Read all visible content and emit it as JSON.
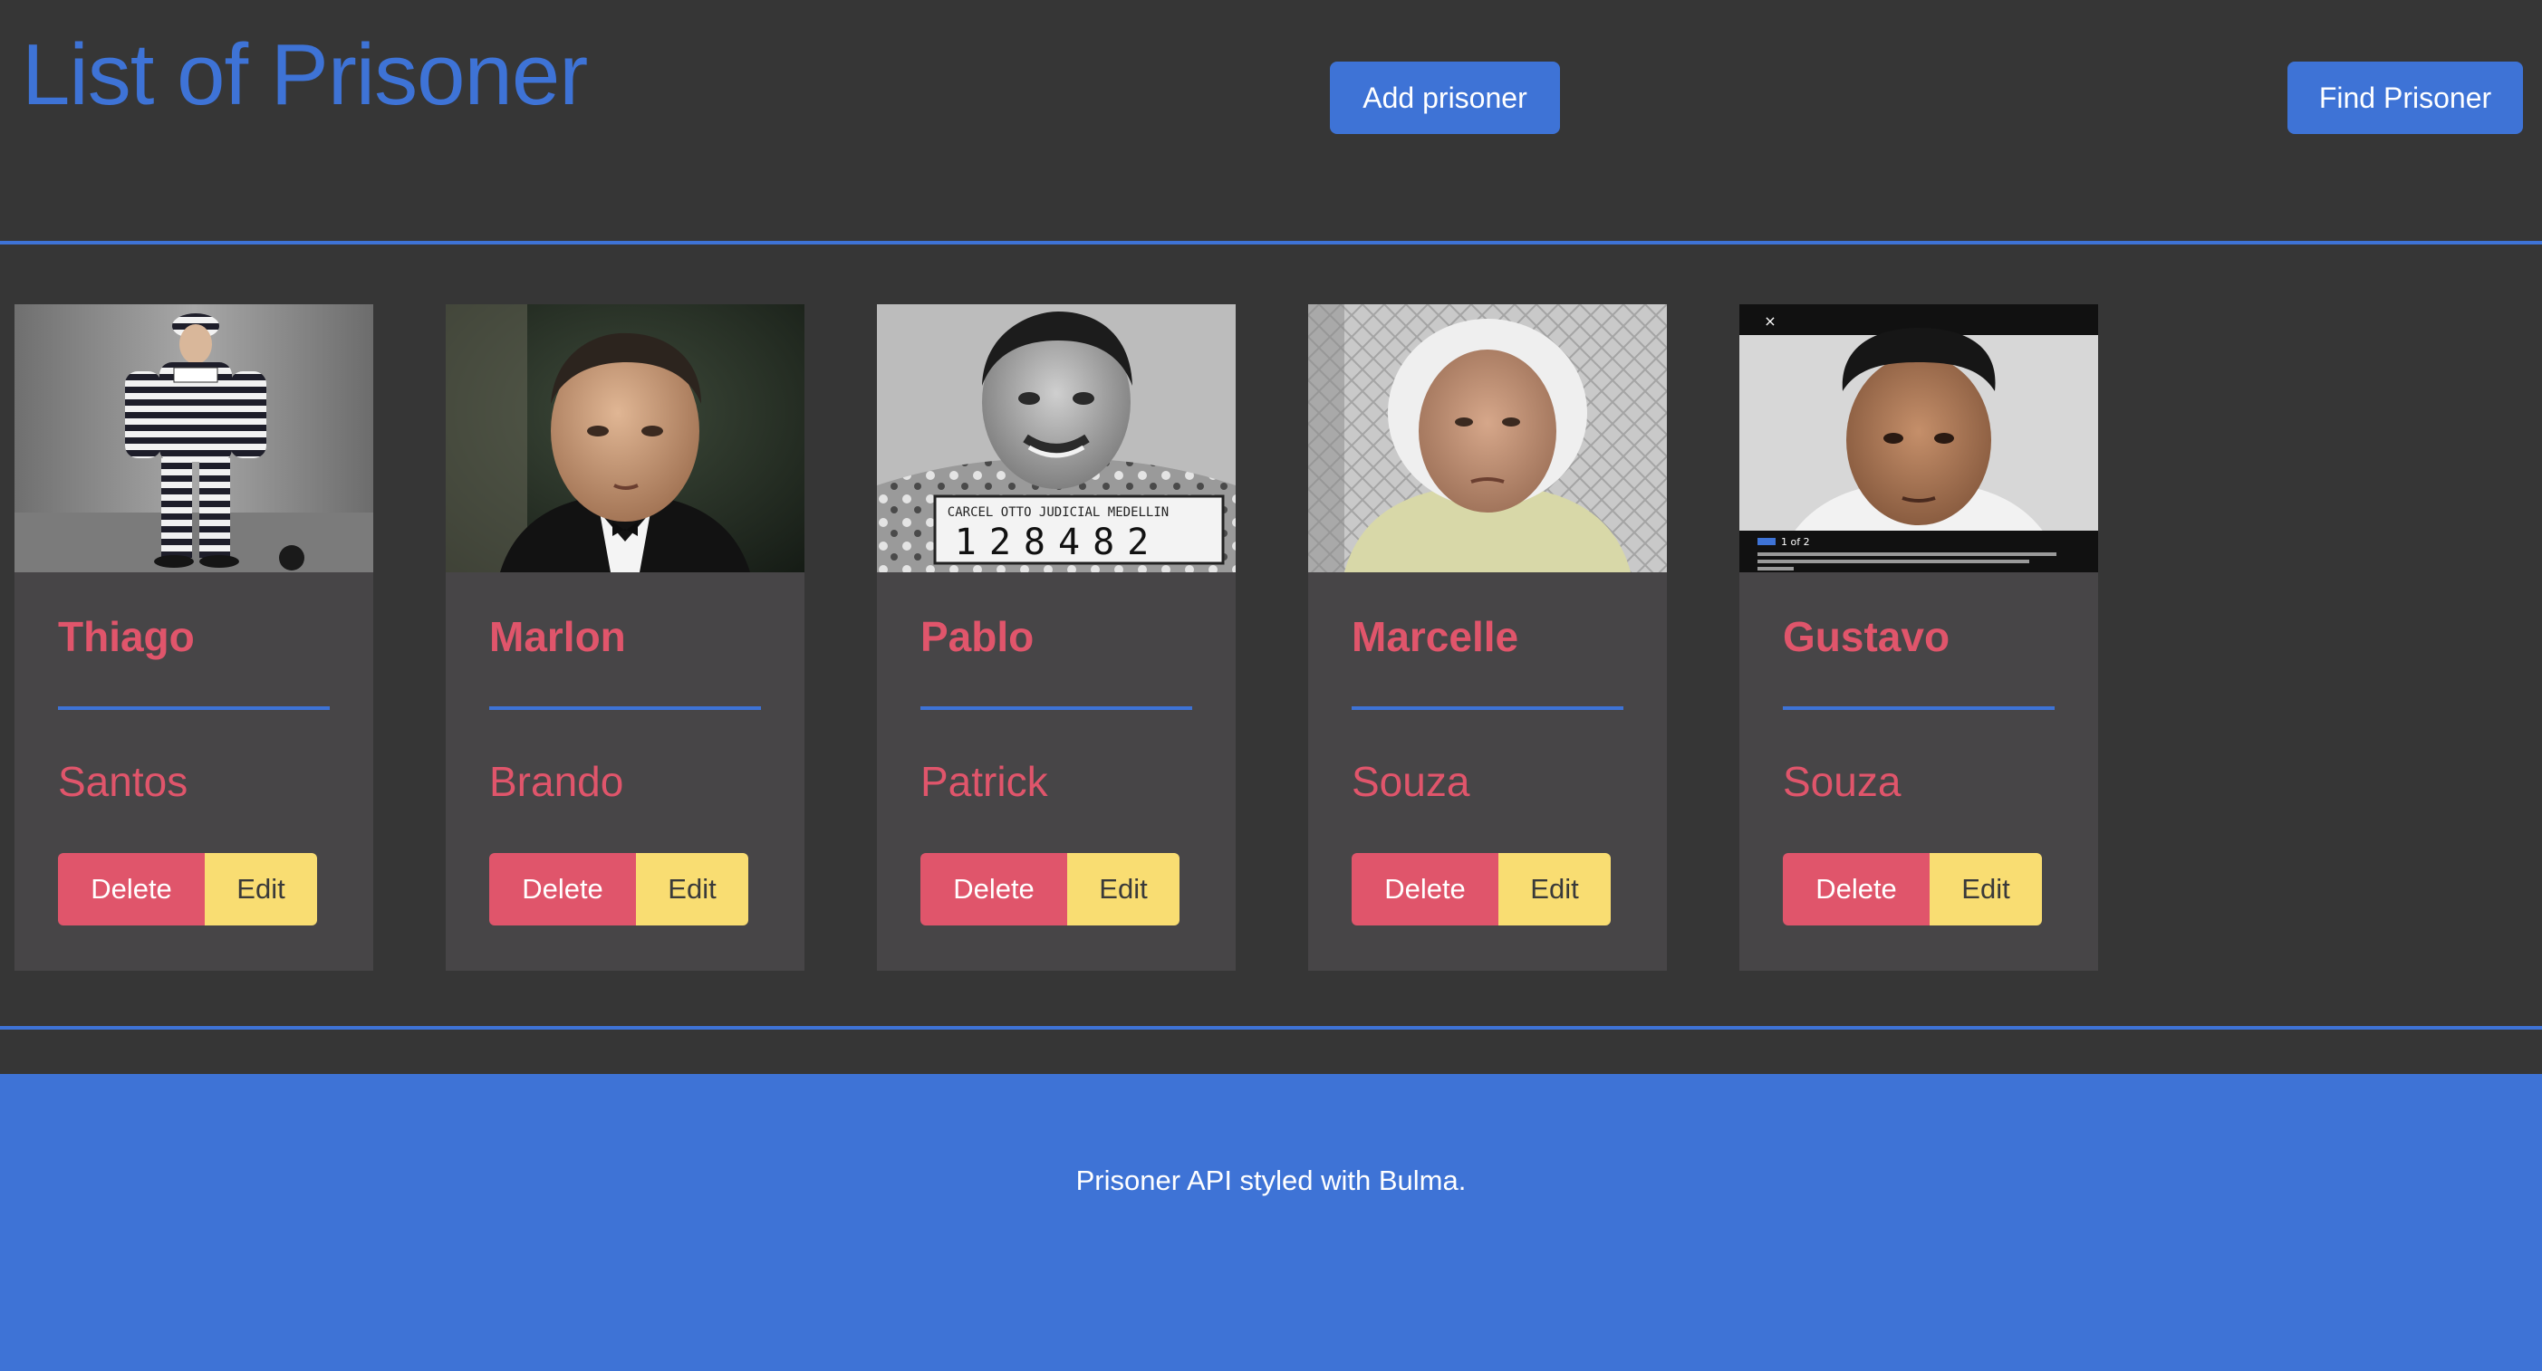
{
  "header": {
    "title": "List of Prisoner",
    "add_button": "Add prisoner",
    "find_button": "Find Prisoner"
  },
  "colors": {
    "primary": "#3E73D6",
    "danger": "#E0556B",
    "warning": "#F9DD72",
    "background": "#363636",
    "card": "#474547"
  },
  "prisoners": [
    {
      "first_name": "Thiago",
      "last_name": "Santos",
      "delete_label": "Delete",
      "edit_label": "Edit",
      "photo": "striped-uniform-photo"
    },
    {
      "first_name": "Marlon",
      "last_name": "Brando",
      "delete_label": "Delete",
      "edit_label": "Edit",
      "photo": "tuxedo-portrait-photo"
    },
    {
      "first_name": "Pablo",
      "last_name": "Patrick",
      "delete_label": "Delete",
      "edit_label": "Edit",
      "photo": "mugshot-photo",
      "photo_placard": "128482",
      "photo_placard_caption": "CARCEL OTTO JUDICIAL MEDELLIN"
    },
    {
      "first_name": "Marcelle",
      "last_name": "Souza",
      "delete_label": "Delete",
      "edit_label": "Edit",
      "photo": "elderly-woman-photo"
    },
    {
      "first_name": "Gustavo",
      "last_name": "Souza",
      "delete_label": "Delete",
      "edit_label": "Edit",
      "photo": "news-mugshot-photo",
      "photo_counter": "1 of 2"
    }
  ],
  "footer": {
    "text": "Prisoner API styled with Bulma."
  }
}
